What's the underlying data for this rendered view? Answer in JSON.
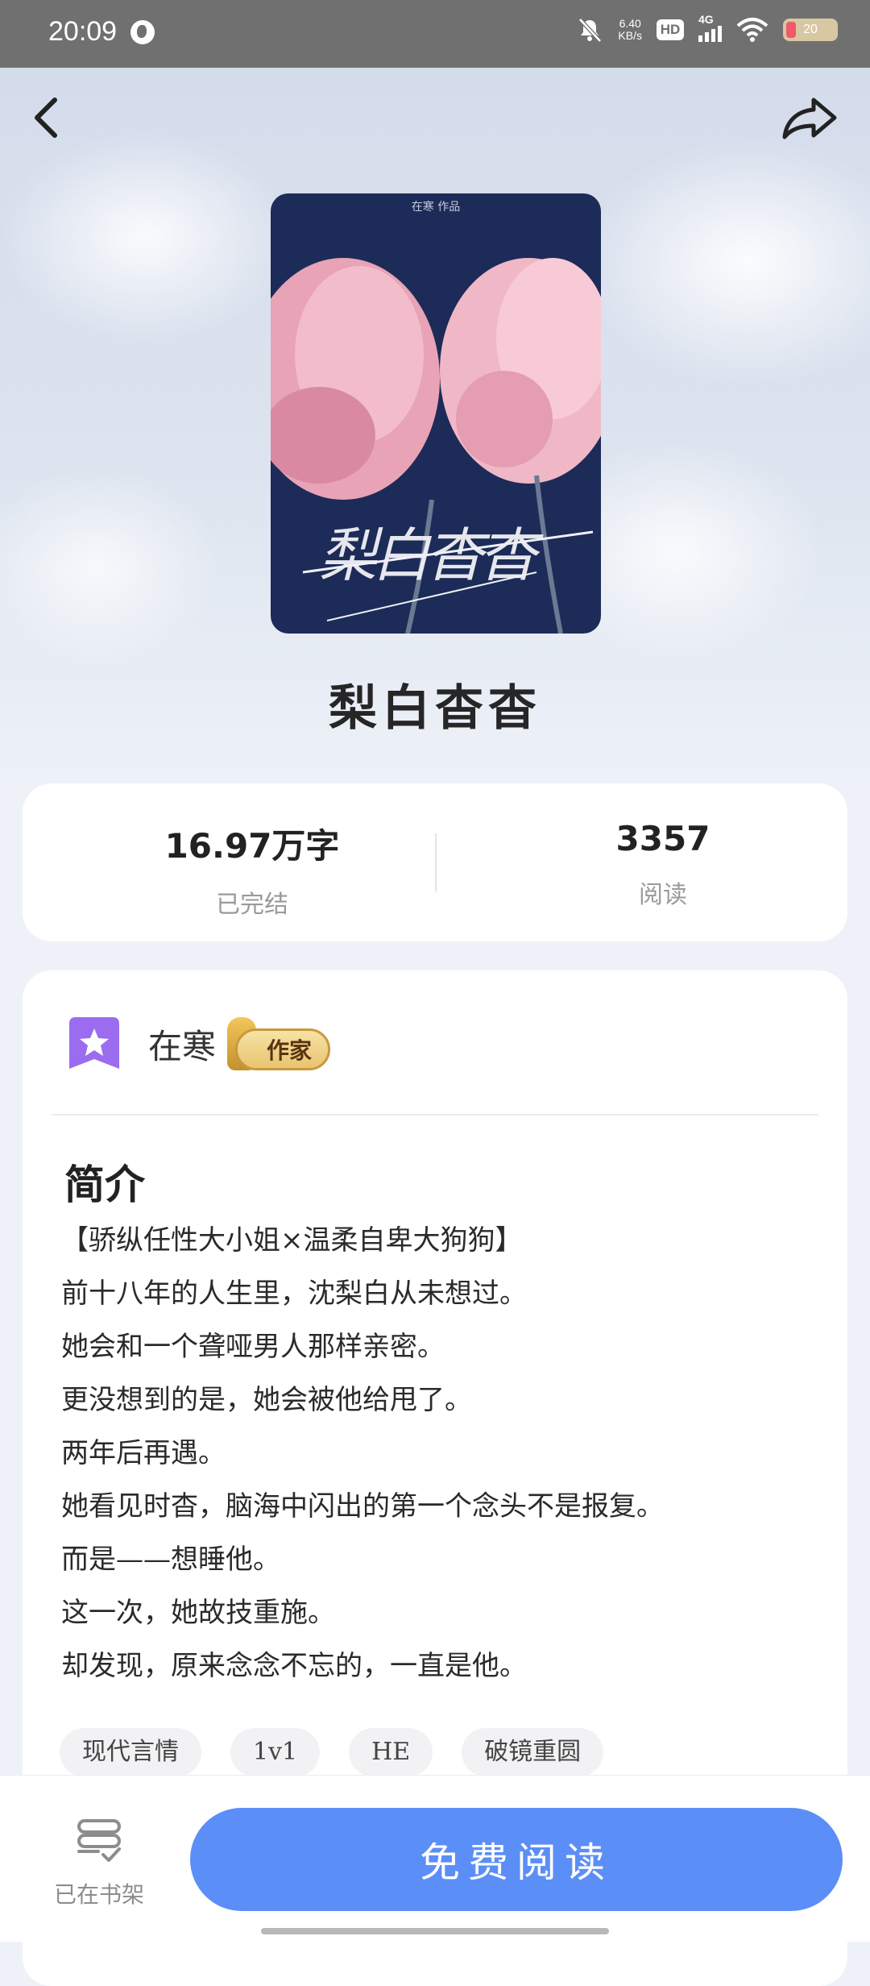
{
  "status_bar": {
    "time": "20:09",
    "net_speed_value": "6.40",
    "net_speed_unit": "KB/s",
    "hd": "HD",
    "network": "4G",
    "battery_level": "20"
  },
  "book": {
    "title": "梨白杳杳",
    "cover_author_text": "在寒 作品",
    "cover_title_text": "梨白杳杳"
  },
  "stats": {
    "word_count": "16.97万字",
    "status": "已完结",
    "reads": "3357",
    "reads_label": "阅读"
  },
  "author": {
    "name": "在寒",
    "badge": "作家"
  },
  "intro": {
    "heading": "简介",
    "lines": [
      "【骄纵任性大小姐×温柔自卑大狗狗】",
      "前十八年的人生里，沈梨白从未想过。",
      "她会和一个聋哑男人那样亲密。",
      "更没想到的是，她会被他给甩了。",
      "两年后再遇。",
      "她看见时杳，脑海中闪出的第一个念头不是报复。",
      "而是——想睡他。",
      "这一次，她故技重施。",
      "却发现，原来念念不忘的，一直是他。"
    ]
  },
  "tags": [
    "现代言情",
    "1v1",
    "HE",
    "破镜重圆"
  ],
  "bottom": {
    "shelf_label": "已在书架",
    "read_label": "免费阅读"
  },
  "colors": {
    "accent": "#5b8ef7",
    "cover_bg": "#1c2b57",
    "avatar": "#9b6cf0"
  }
}
